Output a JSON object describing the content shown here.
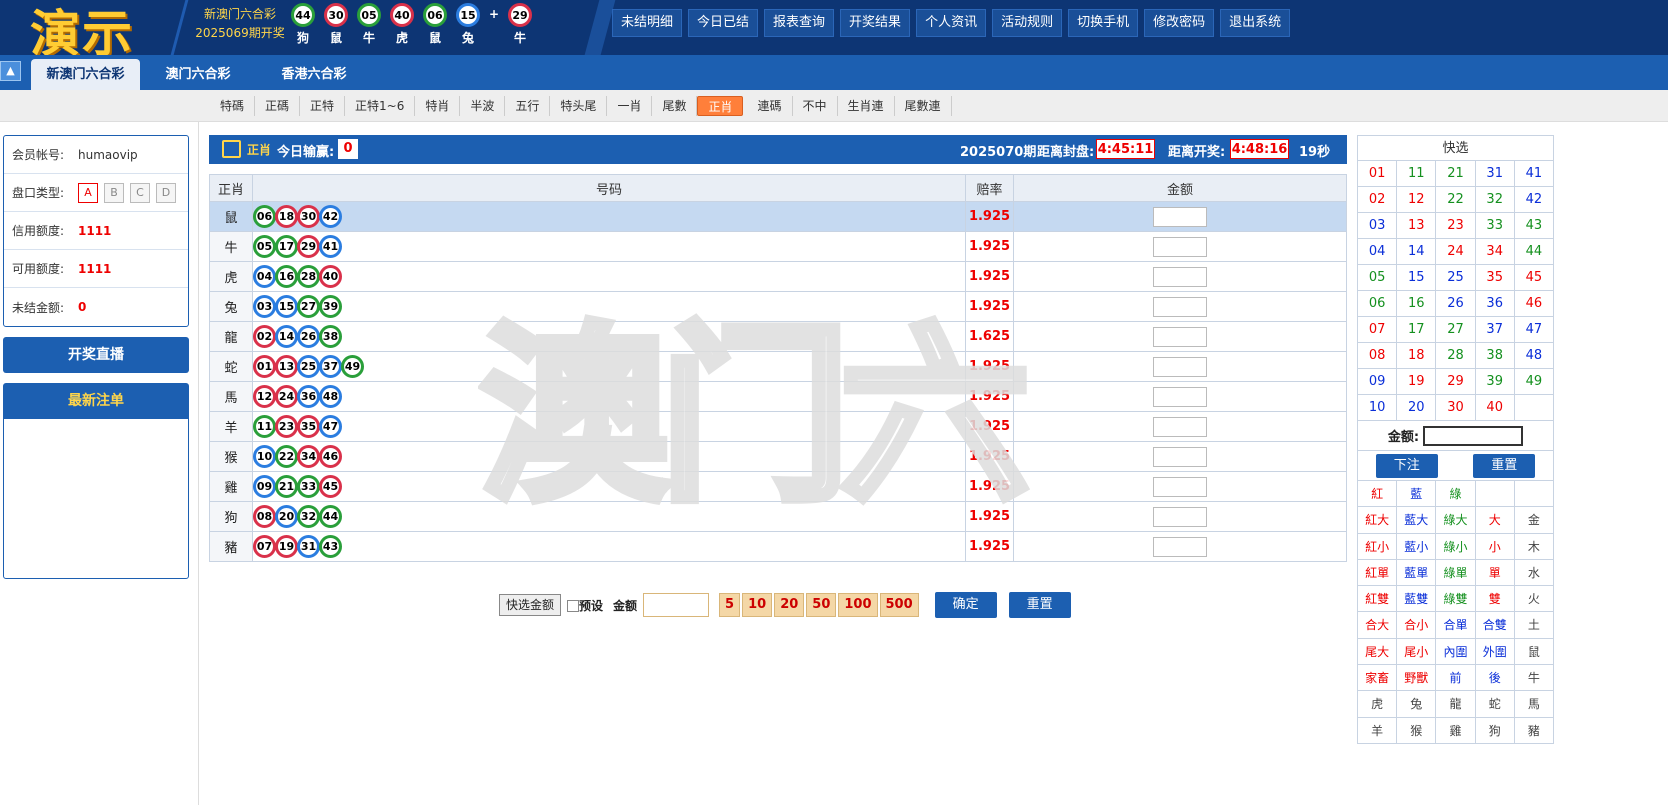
{
  "header": {
    "logo": "演示",
    "lottery_name": "新澳门六合彩",
    "period_label": "2025069期开奖",
    "draw": [
      {
        "n": "44",
        "z": "狗",
        "c": "green"
      },
      {
        "n": "30",
        "z": "鼠",
        "c": "red"
      },
      {
        "n": "05",
        "z": "牛",
        "c": "green"
      },
      {
        "n": "40",
        "z": "虎",
        "c": "red"
      },
      {
        "n": "06",
        "z": "鼠",
        "c": "green"
      },
      {
        "n": "15",
        "z": "兔",
        "c": "blue"
      }
    ],
    "plus": "+",
    "special": {
      "n": "29",
      "z": "牛",
      "c": "red"
    }
  },
  "nav": [
    "未结明细",
    "今日已结",
    "报表查询",
    "开奖结果",
    "个人资讯",
    "活动规则",
    "切换手机",
    "修改密码",
    "退出系统"
  ],
  "tabs": [
    "新澳门六合彩",
    "澳门六合彩",
    "香港六合彩"
  ],
  "subnav": [
    "特碼",
    "正碼",
    "正特",
    "正特1~6",
    "特肖",
    "半波",
    "五行",
    "特头尾",
    "一肖",
    "尾數",
    "正肖",
    "連碼",
    "不中",
    "生肖連",
    "尾數連"
  ],
  "account": {
    "member_label": "会员帐号:",
    "member": "humaovip",
    "pan_label": "盘口类型:",
    "pans": [
      "A",
      "B",
      "C",
      "D"
    ],
    "credit_label": "信用额度:",
    "credit": "1111",
    "avail_label": "可用额度:",
    "avail": "1111",
    "unsettled_label": "未结金额:",
    "unsettled": "0"
  },
  "live_label": "开奖直播",
  "new_orders_label": "最新注单",
  "bar": {
    "play": "正肖",
    "today_label": "今日输赢:",
    "today": "0",
    "period": "2025070期",
    "close_label": "距离封盘:",
    "close_time": "4:45:11",
    "draw_label": "距离开奖:",
    "draw_time": "4:48:16",
    "seconds": "19秒"
  },
  "table": {
    "headers": [
      "正肖",
      "号码",
      "赔率",
      "金额"
    ],
    "rows": [
      {
        "z": "鼠",
        "odds": "1.925",
        "balls": [
          [
            "06",
            "green"
          ],
          [
            "18",
            "red"
          ],
          [
            "30",
            "red"
          ],
          [
            "42",
            "blue"
          ]
        ]
      },
      {
        "z": "牛",
        "odds": "1.925",
        "balls": [
          [
            "05",
            "green"
          ],
          [
            "17",
            "green"
          ],
          [
            "29",
            "red"
          ],
          [
            "41",
            "blue"
          ]
        ]
      },
      {
        "z": "虎",
        "odds": "1.925",
        "balls": [
          [
            "04",
            "blue"
          ],
          [
            "16",
            "green"
          ],
          [
            "28",
            "green"
          ],
          [
            "40",
            "red"
          ]
        ]
      },
      {
        "z": "兔",
        "odds": "1.925",
        "balls": [
          [
            "03",
            "blue"
          ],
          [
            "15",
            "blue"
          ],
          [
            "27",
            "green"
          ],
          [
            "39",
            "green"
          ]
        ]
      },
      {
        "z": "龍",
        "odds": "1.625",
        "balls": [
          [
            "02",
            "red"
          ],
          [
            "14",
            "blue"
          ],
          [
            "26",
            "blue"
          ],
          [
            "38",
            "green"
          ]
        ]
      },
      {
        "z": "蛇",
        "odds": "1.925",
        "balls": [
          [
            "01",
            "red"
          ],
          [
            "13",
            "red"
          ],
          [
            "25",
            "blue"
          ],
          [
            "37",
            "blue"
          ],
          [
            "49",
            "green"
          ]
        ]
      },
      {
        "z": "馬",
        "odds": "1.925",
        "balls": [
          [
            "12",
            "red"
          ],
          [
            "24",
            "red"
          ],
          [
            "36",
            "blue"
          ],
          [
            "48",
            "blue"
          ]
        ]
      },
      {
        "z": "羊",
        "odds": "1.925",
        "balls": [
          [
            "11",
            "green"
          ],
          [
            "23",
            "red"
          ],
          [
            "35",
            "red"
          ],
          [
            "47",
            "blue"
          ]
        ]
      },
      {
        "z": "猴",
        "odds": "1.925",
        "balls": [
          [
            "10",
            "blue"
          ],
          [
            "22",
            "green"
          ],
          [
            "34",
            "red"
          ],
          [
            "46",
            "red"
          ]
        ]
      },
      {
        "z": "雞",
        "odds": "1.925",
        "balls": [
          [
            "09",
            "blue"
          ],
          [
            "21",
            "green"
          ],
          [
            "33",
            "green"
          ],
          [
            "45",
            "red"
          ]
        ]
      },
      {
        "z": "狗",
        "odds": "1.925",
        "balls": [
          [
            "08",
            "red"
          ],
          [
            "20",
            "blue"
          ],
          [
            "32",
            "green"
          ],
          [
            "44",
            "green"
          ]
        ]
      },
      {
        "z": "豬",
        "odds": "1.925",
        "balls": [
          [
            "07",
            "red"
          ],
          [
            "19",
            "red"
          ],
          [
            "31",
            "blue"
          ],
          [
            "43",
            "green"
          ]
        ]
      }
    ]
  },
  "watermark": "澳门六",
  "bottom": {
    "quick": "快选金额",
    "preset": "预设",
    "amount": "金额",
    "chips": [
      "5",
      "10",
      "20",
      "50",
      "100",
      "500"
    ],
    "confirm": "确定",
    "reset": "重置"
  },
  "quick": {
    "title": "快选",
    "numbers": [
      [
        "01",
        "red"
      ],
      [
        "11",
        "green"
      ],
      [
        "21",
        "green"
      ],
      [
        "31",
        "blue"
      ],
      [
        "41",
        "blue"
      ],
      [
        "02",
        "red"
      ],
      [
        "12",
        "red"
      ],
      [
        "22",
        "green"
      ],
      [
        "32",
        "green"
      ],
      [
        "42",
        "blue"
      ],
      [
        "03",
        "blue"
      ],
      [
        "13",
        "red"
      ],
      [
        "23",
        "red"
      ],
      [
        "33",
        "green"
      ],
      [
        "43",
        "green"
      ],
      [
        "04",
        "blue"
      ],
      [
        "14",
        "blue"
      ],
      [
        "24",
        "red"
      ],
      [
        "34",
        "red"
      ],
      [
        "44",
        "green"
      ],
      [
        "05",
        "green"
      ],
      [
        "15",
        "blue"
      ],
      [
        "25",
        "blue"
      ],
      [
        "35",
        "red"
      ],
      [
        "45",
        "red"
      ],
      [
        "06",
        "green"
      ],
      [
        "16",
        "green"
      ],
      [
        "26",
        "blue"
      ],
      [
        "36",
        "blue"
      ],
      [
        "46",
        "red"
      ],
      [
        "07",
        "red"
      ],
      [
        "17",
        "green"
      ],
      [
        "27",
        "green"
      ],
      [
        "37",
        "blue"
      ],
      [
        "47",
        "blue"
      ],
      [
        "08",
        "red"
      ],
      [
        "18",
        "red"
      ],
      [
        "28",
        "green"
      ],
      [
        "38",
        "green"
      ],
      [
        "48",
        "blue"
      ],
      [
        "09",
        "blue"
      ],
      [
        "19",
        "red"
      ],
      [
        "29",
        "red"
      ],
      [
        "39",
        "green"
      ],
      [
        "49",
        "green"
      ],
      [
        "10",
        "blue"
      ],
      [
        "20",
        "blue"
      ],
      [
        "30",
        "red"
      ],
      [
        "40",
        "red"
      ],
      [
        "",
        ""
      ]
    ],
    "amount_label": "金额:",
    "bet": "下注",
    "reset": "重置",
    "options": [
      [
        "紅",
        "red"
      ],
      [
        "藍",
        "blue"
      ],
      [
        "綠",
        "green"
      ],
      [
        "",
        ""
      ],
      [
        "",
        ""
      ],
      [
        "紅大",
        "red"
      ],
      [
        "藍大",
        "blue"
      ],
      [
        "綠大",
        "green"
      ],
      [
        "大",
        "red"
      ],
      [
        "金",
        "grey"
      ],
      [
        "紅小",
        "red"
      ],
      [
        "藍小",
        "blue"
      ],
      [
        "綠小",
        "green"
      ],
      [
        "小",
        "red"
      ],
      [
        "木",
        "grey"
      ],
      [
        "紅單",
        "red"
      ],
      [
        "藍單",
        "blue"
      ],
      [
        "綠單",
        "green"
      ],
      [
        "單",
        "red"
      ],
      [
        "水",
        "grey"
      ],
      [
        "紅雙",
        "red"
      ],
      [
        "藍雙",
        "blue"
      ],
      [
        "綠雙",
        "green"
      ],
      [
        "雙",
        "red"
      ],
      [
        "火",
        "grey"
      ],
      [
        "合大",
        "red"
      ],
      [
        "合小",
        "red"
      ],
      [
        "合單",
        "blue"
      ],
      [
        "合雙",
        "blue"
      ],
      [
        "土",
        "grey"
      ],
      [
        "尾大",
        "red"
      ],
      [
        "尾小",
        "red"
      ],
      [
        "內圍",
        "blue"
      ],
      [
        "外圍",
        "blue"
      ],
      [
        "鼠",
        "grey"
      ],
      [
        "家畜",
        "red"
      ],
      [
        "野獸",
        "red"
      ],
      [
        "前",
        "blue"
      ],
      [
        "後",
        "blue"
      ],
      [
        "牛",
        "grey"
      ],
      [
        "虎",
        "grey"
      ],
      [
        "兔",
        "grey"
      ],
      [
        "龍",
        "grey"
      ],
      [
        "蛇",
        "grey"
      ],
      [
        "馬",
        "grey"
      ],
      [
        "羊",
        "grey"
      ],
      [
        "猴",
        "grey"
      ],
      [
        "雞",
        "grey"
      ],
      [
        "狗",
        "grey"
      ],
      [
        "豬",
        "grey"
      ]
    ]
  }
}
